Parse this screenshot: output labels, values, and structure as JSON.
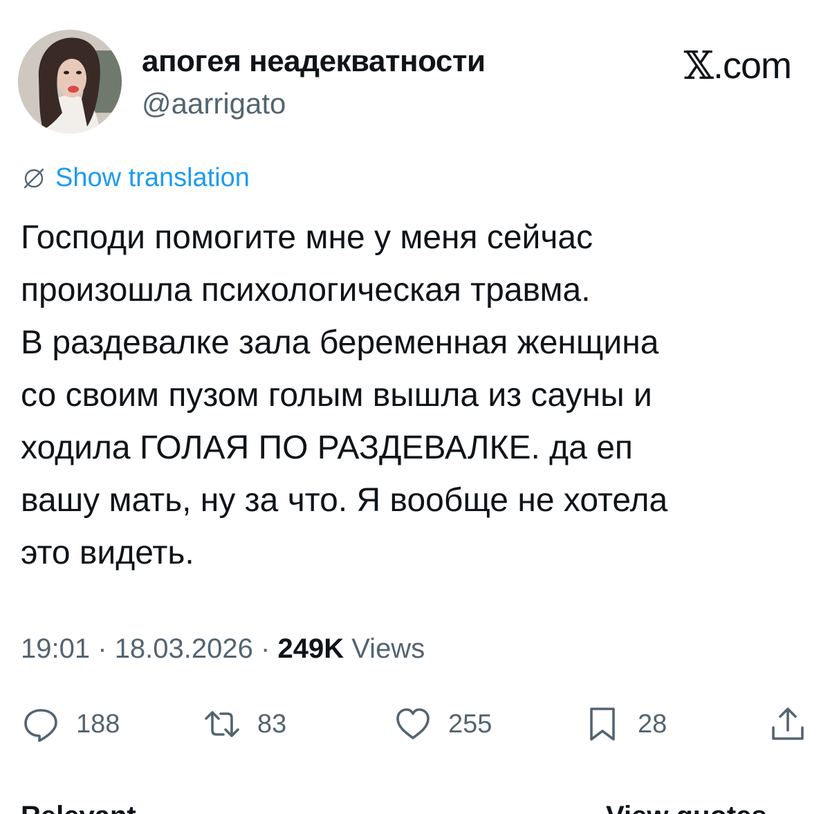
{
  "author": {
    "display_name": "апогея неадекватности",
    "handle": "@aarrigato"
  },
  "brand": {
    "x_glyph": "𝕏",
    "suffix": ".com"
  },
  "translation": {
    "link_label": "Show translation",
    "icon": "globe-icon"
  },
  "tweet": {
    "text": "Господи помогите мне у меня сейчас\nпроизошла психологическая травма.\nВ раздевалке зала беременная женщина\nсо своим пузом голым вышла из сауны и\nходила ГОЛАЯ ПО РАЗДЕВАЛКЕ. да еп\nвашу мать, ну за что. Я вообще не хотела\nэто видеть."
  },
  "meta": {
    "time": "19:01",
    "separator": "·",
    "date": "18.03.2026",
    "views_count": "249K",
    "views_label": "Views"
  },
  "actions": {
    "reply_count": "188",
    "retweet_count": "83",
    "like_count": "255",
    "bookmark_count": "28"
  },
  "footer": {
    "left_label": "Relevant",
    "right_label": "View quotes"
  },
  "colors": {
    "link_blue": "#1d9bf0",
    "secondary_gray": "#536471",
    "text_black": "#0f1419"
  }
}
